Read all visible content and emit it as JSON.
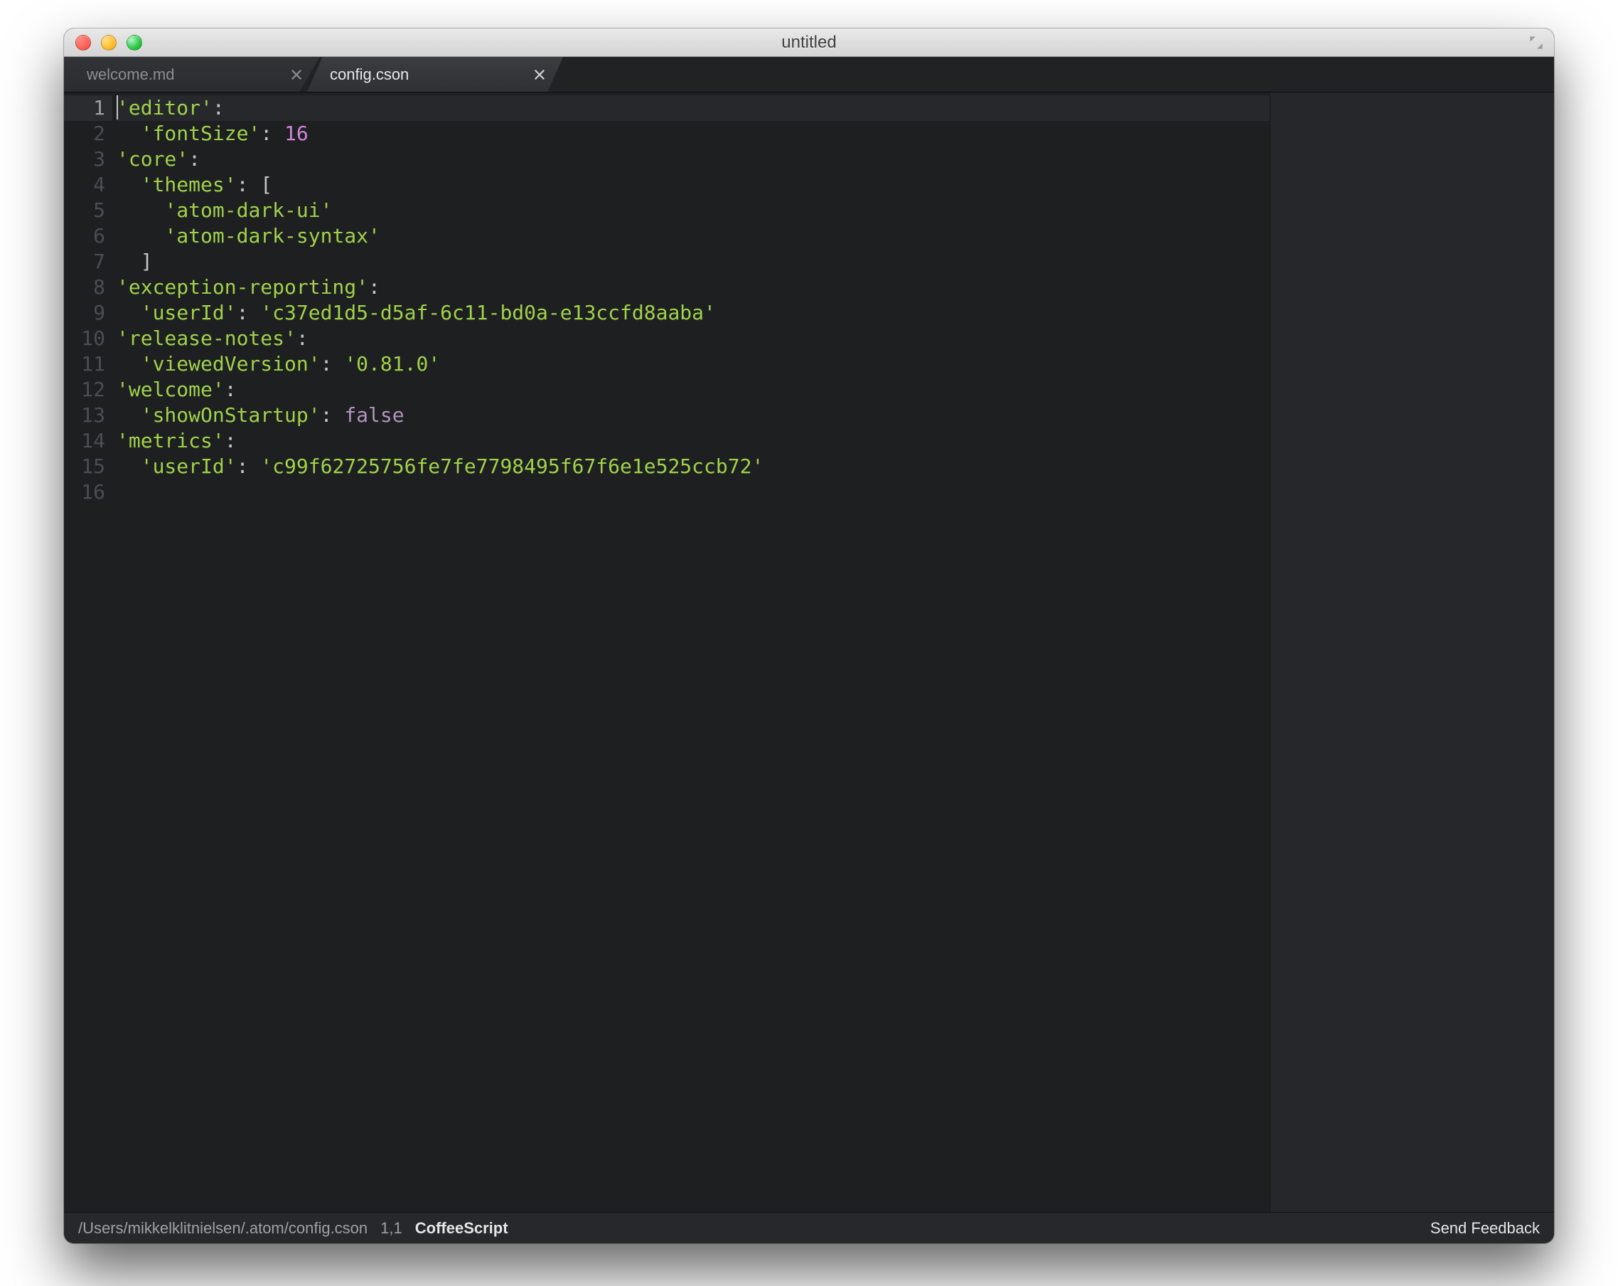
{
  "window": {
    "title": "untitled"
  },
  "tabs": [
    {
      "label": "welcome.md",
      "active": false
    },
    {
      "label": "config.cson",
      "active": true
    }
  ],
  "gutter": {
    "count": 16,
    "active": 1
  },
  "code": {
    "lines": [
      [
        {
          "t": "str",
          "v": "'editor'"
        },
        {
          "t": "punc",
          "v": ":"
        }
      ],
      [
        {
          "t": "punc",
          "v": "  "
        },
        {
          "t": "str",
          "v": "'fontSize'"
        },
        {
          "t": "punc",
          "v": ": "
        },
        {
          "t": "num",
          "v": "16"
        }
      ],
      [
        {
          "t": "str",
          "v": "'core'"
        },
        {
          "t": "punc",
          "v": ":"
        }
      ],
      [
        {
          "t": "punc",
          "v": "  "
        },
        {
          "t": "str",
          "v": "'themes'"
        },
        {
          "t": "punc",
          "v": ": ["
        }
      ],
      [
        {
          "t": "punc",
          "v": "    "
        },
        {
          "t": "str",
          "v": "'atom-dark-ui'"
        }
      ],
      [
        {
          "t": "punc",
          "v": "    "
        },
        {
          "t": "str",
          "v": "'atom-dark-syntax'"
        }
      ],
      [
        {
          "t": "punc",
          "v": "  ]"
        }
      ],
      [
        {
          "t": "str",
          "v": "'exception-reporting'"
        },
        {
          "t": "punc",
          "v": ":"
        }
      ],
      [
        {
          "t": "punc",
          "v": "  "
        },
        {
          "t": "str",
          "v": "'userId'"
        },
        {
          "t": "punc",
          "v": ": "
        },
        {
          "t": "str",
          "v": "'c37ed1d5-d5af-6c11-bd0a-e13ccfd8aaba'"
        }
      ],
      [
        {
          "t": "str",
          "v": "'release-notes'"
        },
        {
          "t": "punc",
          "v": ":"
        }
      ],
      [
        {
          "t": "punc",
          "v": "  "
        },
        {
          "t": "str",
          "v": "'viewedVersion'"
        },
        {
          "t": "punc",
          "v": ": "
        },
        {
          "t": "str",
          "v": "'0.81.0'"
        }
      ],
      [
        {
          "t": "str",
          "v": "'welcome'"
        },
        {
          "t": "punc",
          "v": ":"
        }
      ],
      [
        {
          "t": "punc",
          "v": "  "
        },
        {
          "t": "str",
          "v": "'showOnStartup'"
        },
        {
          "t": "punc",
          "v": ": "
        },
        {
          "t": "bool",
          "v": "false"
        }
      ],
      [
        {
          "t": "str",
          "v": "'metrics'"
        },
        {
          "t": "punc",
          "v": ":"
        }
      ],
      [
        {
          "t": "punc",
          "v": "  "
        },
        {
          "t": "str",
          "v": "'userId'"
        },
        {
          "t": "punc",
          "v": ": "
        },
        {
          "t": "str",
          "v": "'c99f62725756fe7fe7798495f67f6e1e525ccb72'"
        }
      ],
      []
    ]
  },
  "statusbar": {
    "path": "/Users/mikkelklitnielsen/.atom/config.cson",
    "pos": "1,1",
    "lang": "CoffeeScript",
    "feedback": "Send Feedback"
  }
}
